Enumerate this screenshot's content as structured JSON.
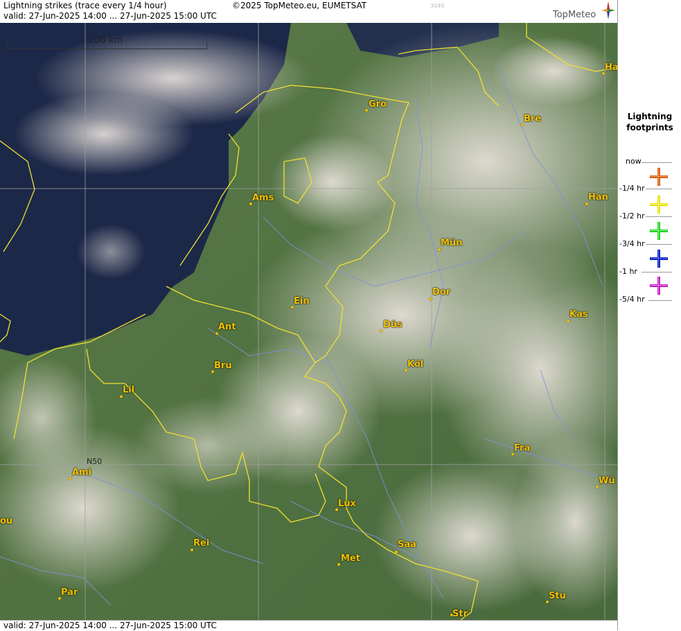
{
  "header": {
    "title": "Lightning strikes (trace every 1/4 hour)",
    "valid": "valid:  27-Jun-2025 14:00 ... 27-Jun-2025 15:00 UTC",
    "copyright": "©2025 TopMeteo.eu, EUMETSAT",
    "code": "3040",
    "logo": "TopMeteo"
  },
  "footer": {
    "valid": "valid:  27-Jun-2025 14:00 ... 27-Jun-2025 15:00 UTC"
  },
  "map": {
    "scale_label": "200 km",
    "graticule_label": "N50",
    "cities": [
      "Gro",
      "Bre",
      "Ha",
      "Ams",
      "Han",
      "Mün",
      "Ein",
      "Dor",
      "Ant",
      "Düs",
      "Kas",
      "Köl",
      "Bru",
      "Lil",
      "Fra",
      "Ami",
      "Wü",
      "ou",
      "Lux",
      "Rei",
      "Saa",
      "Met",
      "Par",
      "Stu",
      "Str"
    ]
  },
  "legend": {
    "title_line1": "Lightning",
    "title_line2": "footprints",
    "steps": [
      {
        "label": "now",
        "color": "#d86018"
      },
      {
        "label": "-1/4 hr",
        "color": "#e8e000"
      },
      {
        "label": "-1/2 hr",
        "color": "#20d020"
      },
      {
        "label": "-3/4 hr",
        "color": "#1020c0"
      },
      {
        "label": "-1 hr",
        "color": "#c020c0"
      },
      {
        "label": "-5/4 hr"
      }
    ]
  },
  "colors": {
    "border": "#f0e030",
    "river": "#8090e0",
    "sea": "#1a2540",
    "land": "#4f7040",
    "cloud": "#e6dcd6",
    "city": "#f2c200"
  }
}
